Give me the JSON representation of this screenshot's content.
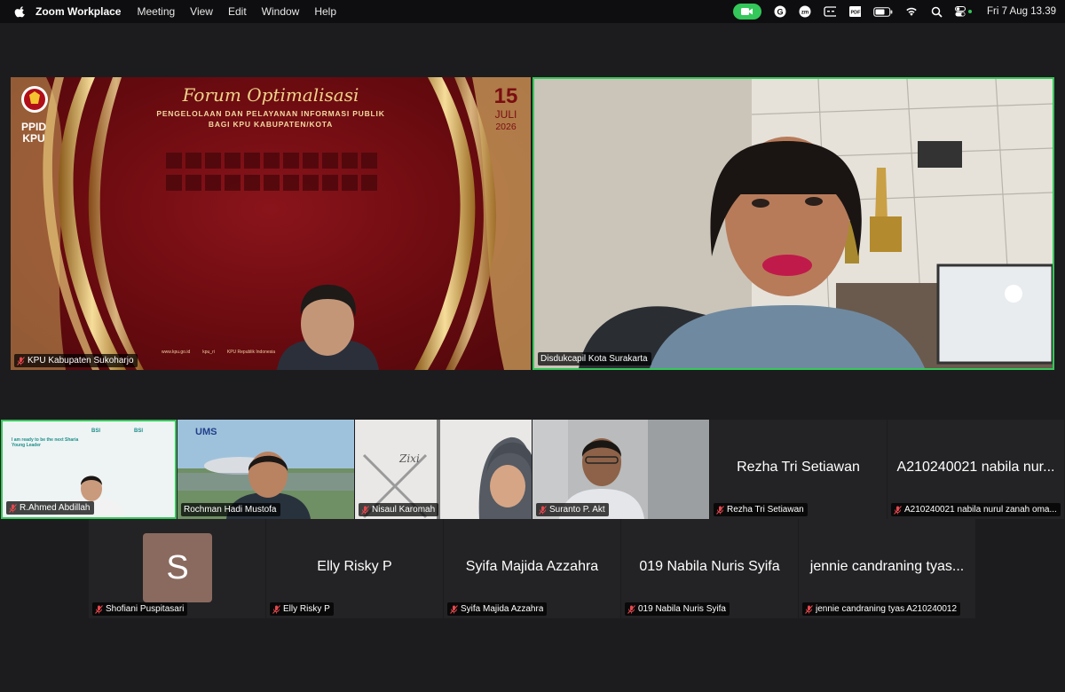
{
  "menubar": {
    "app_name": "Zoom Workplace",
    "menus": [
      "Meeting",
      "View",
      "Edit",
      "Window",
      "Help"
    ],
    "clock": "Fri 7 Aug  13.39",
    "status_icons": [
      "video-camera-icon",
      "grammarly-icon",
      "zoom-icon",
      "caption-icon",
      "pdf-icon",
      "battery-icon",
      "wifi-icon",
      "search-icon",
      "control-center-icon"
    ]
  },
  "presentation": {
    "title": "Forum Optimalisasi",
    "subtitle_line1": "PENGELOLAAN DAN PELAYANAN INFORMASI PUBLIK",
    "subtitle_line2": "BAGI KPU KABUPATEN/KOTA",
    "date_day": "15",
    "date_month": "JULI",
    "date_year": "2026",
    "logo_text_1": "PPID",
    "logo_text_2": "KPU",
    "footer_items": [
      "www.kpu.go.id",
      "kpu_ri",
      "KPU Republik Indonesia"
    ]
  },
  "main_tiles": [
    {
      "name": "KPU Kabupaten Sukoharjo",
      "muted": true,
      "active_speaker": false
    },
    {
      "name": "Disdukcapil Kota Surakarta",
      "muted": false,
      "active_speaker": true
    }
  ],
  "row1_tiles": [
    {
      "name": "R.Ahmed Abdillah",
      "muted": true,
      "video": true,
      "active_speaker": true
    },
    {
      "name": "Rochman Hadi Mustofa",
      "muted": false,
      "video": true
    },
    {
      "name": "Nisaul Karomah",
      "muted": true,
      "video": true
    },
    {
      "name": "Suranto P. Akt",
      "muted": true,
      "video": true
    },
    {
      "name": "Rezha Tri Setiawan",
      "display_name": "Rezha Tri Setiawan",
      "muted": true,
      "video": false
    },
    {
      "name": "A210240021 nabila nurul zanah oma...",
      "display_name": "A210240021 nabila nur...",
      "muted": true,
      "video": false
    }
  ],
  "row2_tiles": [
    {
      "name": "Shofiani Puspitasari",
      "avatar_letter": "S",
      "muted": true,
      "video": false
    },
    {
      "name": "Elly Risky P",
      "display_name": "Elly Risky P",
      "muted": true,
      "video": false
    },
    {
      "name": "Syifa Majida Azzahra",
      "display_name": "Syifa Majida Azzahra",
      "muted": true,
      "video": false
    },
    {
      "name": "019 Nabila Nuris Syifa",
      "display_name": "019 Nabila Nuris Syifa",
      "muted": true,
      "video": false
    },
    {
      "name": "jennie candraning tyas A210240012",
      "display_name": "jennie candraning tyas...",
      "muted": true,
      "video": false
    }
  ],
  "colors": {
    "active_border": "#35c759",
    "mute": "#e5484d",
    "tile_bg": "#232325",
    "avatar_bg": "#8a6a5f"
  },
  "slides_mini": {
    "bsi_heading": "I am ready to be the next Sharia Young Leader",
    "bsi_brand": "BSI",
    "ums_brand": "UMS",
    "wall_sign": "Zixi"
  }
}
